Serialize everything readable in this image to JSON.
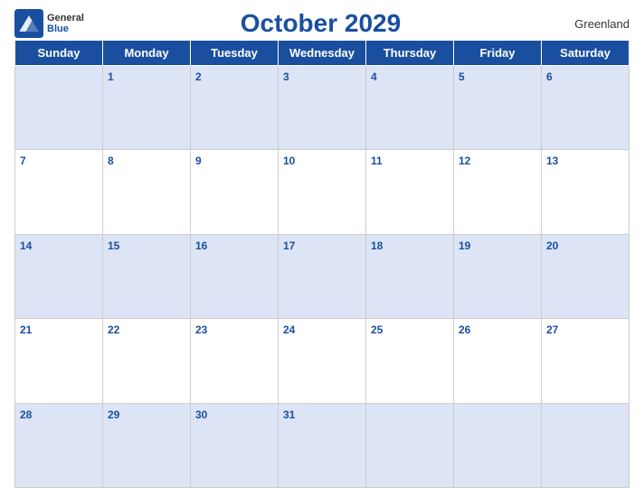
{
  "logo": {
    "general": "General",
    "blue": "Blue"
  },
  "title": "October 2029",
  "region": "Greenland",
  "weekdays": [
    "Sunday",
    "Monday",
    "Tuesday",
    "Wednesday",
    "Thursday",
    "Friday",
    "Saturday"
  ],
  "weeks": [
    [
      null,
      1,
      2,
      3,
      4,
      5,
      6
    ],
    [
      7,
      8,
      9,
      10,
      11,
      12,
      13
    ],
    [
      14,
      15,
      16,
      17,
      18,
      19,
      20
    ],
    [
      21,
      22,
      23,
      24,
      25,
      26,
      27
    ],
    [
      28,
      29,
      30,
      31,
      null,
      null,
      null
    ]
  ]
}
